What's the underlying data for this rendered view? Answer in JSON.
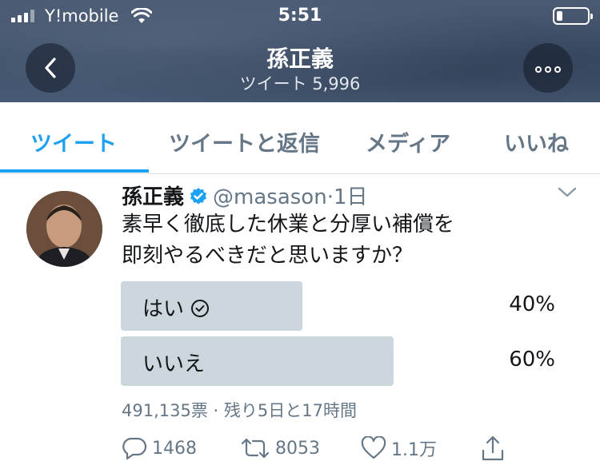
{
  "status_bar": {
    "carrier": "Y!mobile",
    "time": "5:51"
  },
  "header": {
    "name": "孫正義",
    "tweet_count": "ツイート 5,996"
  },
  "tabs": [
    {
      "label": "ツイート",
      "active": true
    },
    {
      "label": "ツイートと返信",
      "active": false
    },
    {
      "label": "メディア",
      "active": false
    },
    {
      "label": "いいね",
      "active": false
    }
  ],
  "tweet": {
    "name": "孫正義",
    "handle": "@masason",
    "separator": "·",
    "time": "1日",
    "text_line1": "素早く徹底した休業と分厚い補償を",
    "text_line2": "即刻やるべきだと思いますか？",
    "poll": {
      "options": [
        {
          "label": "はい",
          "percent_text": "40%",
          "fraction": 0.4,
          "selected": true
        },
        {
          "label": "いいえ",
          "percent_text": "60%",
          "fraction": 0.6,
          "selected": false
        }
      ],
      "meta": "491,135票 · 残り5日と17時間"
    },
    "actions": {
      "reply_count": "1468",
      "retweet_count": "8053",
      "like_count": "1.1万"
    }
  },
  "colors": {
    "accent": "#1da1f2",
    "muted": "#657786",
    "poll_bar": "#ccd6dd"
  },
  "icons": [
    "signal-icon",
    "wifi-icon",
    "battery-icon",
    "back-arrow-icon",
    "more-icon",
    "verified-badge-icon",
    "chevron-down-icon",
    "check-circle-icon",
    "reply-icon",
    "retweet-icon",
    "like-icon",
    "share-icon"
  ]
}
